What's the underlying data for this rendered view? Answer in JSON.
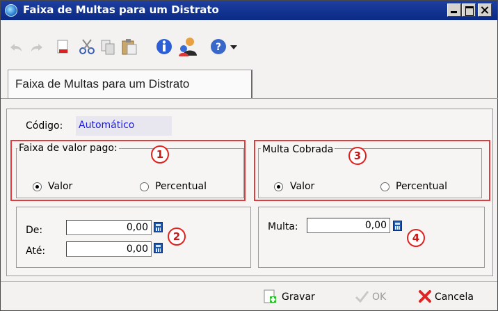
{
  "window": {
    "title": "Faixa de Multas para um Distrato"
  },
  "toolbar": {
    "buttons": [
      {
        "name": "cut-icon"
      },
      {
        "name": "copy-icon"
      },
      {
        "name": "paste-icon"
      },
      {
        "name": "info-icon"
      },
      {
        "name": "users-icon"
      },
      {
        "name": "help-icon"
      }
    ]
  },
  "tab": {
    "label": "Faixa de Multas para um Distrato"
  },
  "form": {
    "codigo_label": "Código:",
    "codigo_value": "Automático",
    "faixa_group": {
      "legend": "Faixa de valor pago:",
      "option_valor": "Valor",
      "option_percentual": "Percentual",
      "selected": "Valor",
      "de_label": "De:",
      "de_value": "0,00",
      "ate_label": "Até:",
      "ate_value": "0,00"
    },
    "multa_group": {
      "legend": "Multa Cobrada",
      "option_valor": "Valor",
      "option_percentual": "Percentual",
      "selected": "Valor",
      "multa_label": "Multa:",
      "multa_value": "0,00"
    }
  },
  "annotations": {
    "badge1": "1",
    "badge2": "2",
    "badge3": "3",
    "badge4": "4"
  },
  "footer": {
    "gravar": "Gravar",
    "ok": "OK",
    "cancela": "Cancela"
  },
  "colors": {
    "title_bar": "#0b2a85",
    "annotation_red": "#e23b3b",
    "value_blue": "#1a1ae6"
  }
}
